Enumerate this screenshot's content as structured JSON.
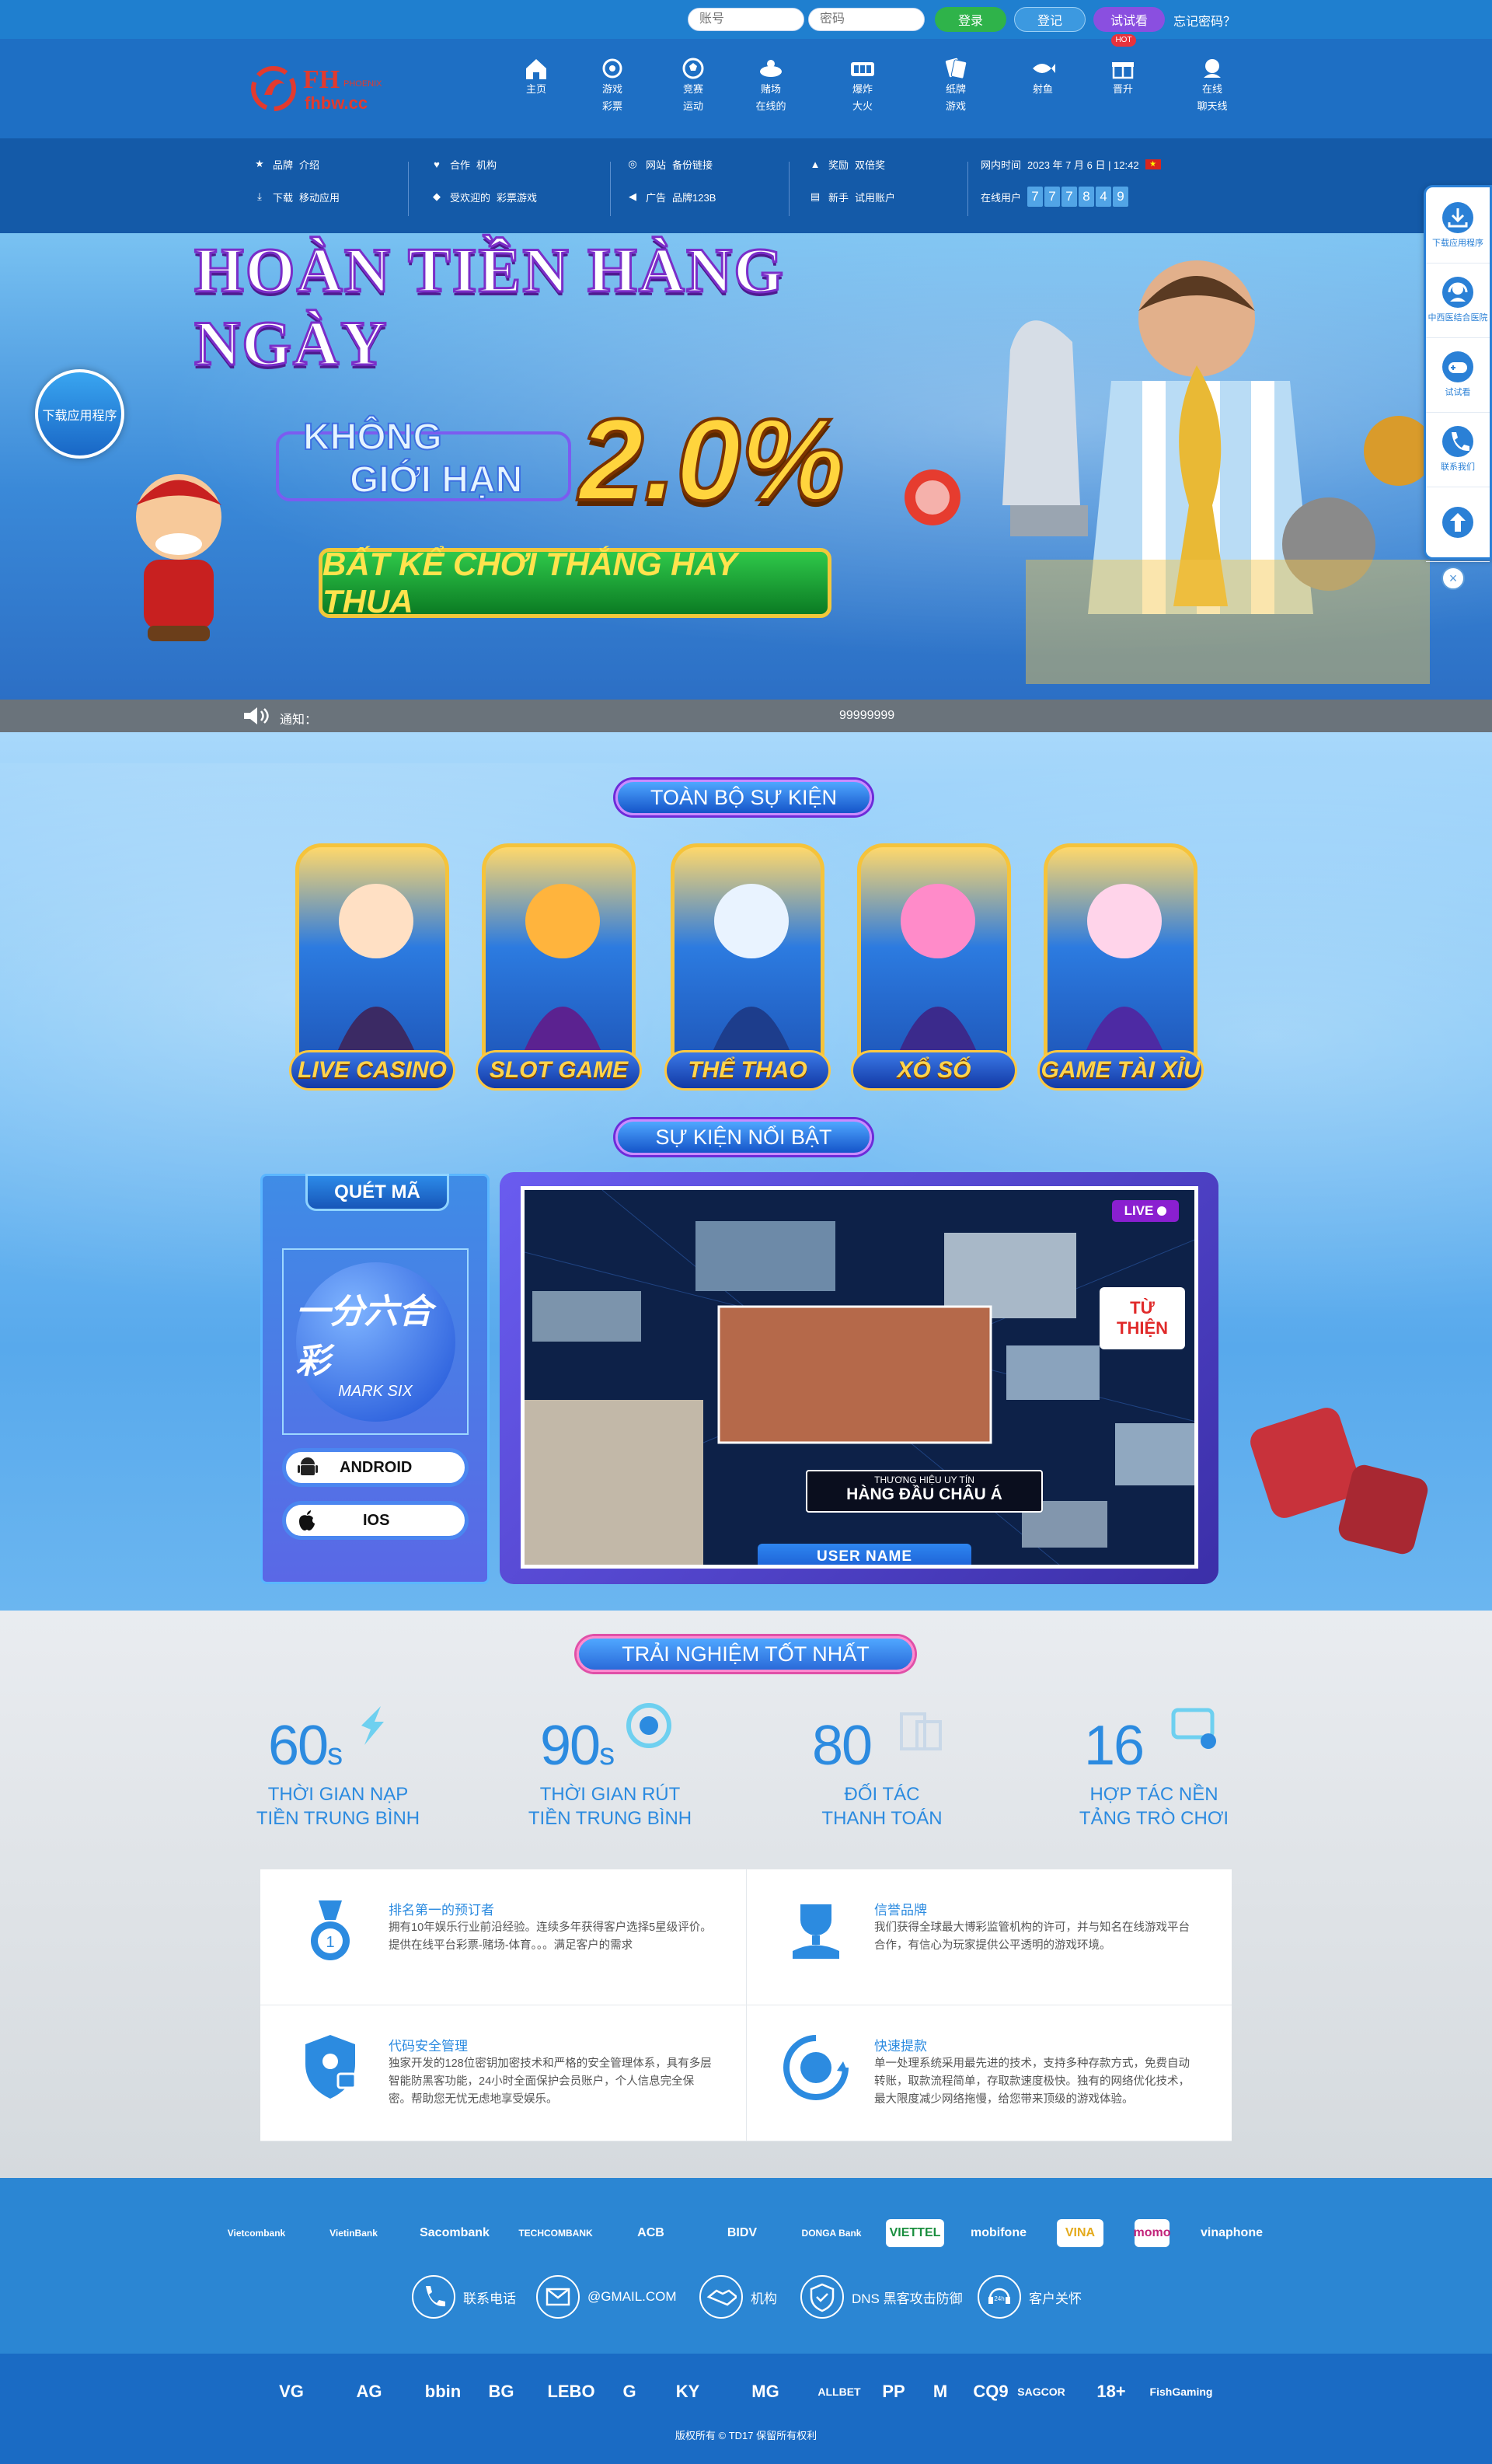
{
  "topbar": {
    "username_placeholder": "账号",
    "password_placeholder": "密码",
    "login_label": "登录",
    "register_label": "登记",
    "trial_label": "试试看",
    "hot_badge": "HOT",
    "forgot_label": "忘记密码？"
  },
  "logo": {
    "brand": "FH",
    "sub": "fhbw.cc",
    "tag": "PHOENIX"
  },
  "nav": {
    "items": [
      {
        "label": "主页",
        "icon": "home-icon"
      },
      {
        "label": "游戏彩票",
        "icon": "lottery-ball-icon"
      },
      {
        "label": "竞赛运动",
        "icon": "soccer-ball-icon"
      },
      {
        "label": "赌场在线的",
        "icon": "casino-chip-icon"
      },
      {
        "label": "爆炸大火",
        "icon": "slot-machine-icon"
      },
      {
        "label": "纸牌游戏",
        "icon": "cards-icon"
      },
      {
        "label": "射鱼",
        "icon": "fish-icon"
      },
      {
        "label": "晋升",
        "icon": "gift-icon"
      },
      {
        "label": "在线聊天线",
        "icon": "chat-agent-icon"
      }
    ]
  },
  "info": {
    "g1": {
      "a_label": "品牌",
      "a_val": "介绍",
      "b_label": "下载",
      "b_val": "移动应用"
    },
    "g2": {
      "a_label": "合作",
      "a_val": "机构",
      "b_label": "受欢迎的",
      "b_val": "彩票游戏"
    },
    "g3": {
      "a_label": "网站",
      "a_val": "备份链接",
      "b_label": "广告",
      "b_val": "品牌123B"
    },
    "g4": {
      "a_label": "奖励",
      "a_val": "双倍奖",
      "b_label": "新手",
      "b_val": "试用账户"
    },
    "time_label": "网内时间",
    "time_value": "2023 年 7 月 6 日 | 12:42",
    "online_label": "在线用户",
    "online_digits": [
      "7",
      "7",
      "7",
      "8",
      "4",
      "9"
    ]
  },
  "banner": {
    "headline": "HOÀN TIỀN HÀNG NGÀY",
    "limit_line1": "KHÔNG",
    "limit_line2": "GIỚI HẠN",
    "percent": "2.0%",
    "ribbon": "BẤT KỂ CHƠI THẮNG HAY THUA",
    "app_download": "下载应用程序"
  },
  "notice": {
    "label": "通知：",
    "text": "99999999"
  },
  "events": {
    "all_title": "TOÀN BỘ SỰ KIỆN",
    "cards": [
      {
        "label": "LIVE CASINO"
      },
      {
        "label": "SLOT GAME"
      },
      {
        "label": "THỂ THAO"
      },
      {
        "label": "XỔ SỐ"
      },
      {
        "label": "GAME TÀI XỈU"
      }
    ],
    "featured_title": "SỰ KIỆN NỔI BẬT",
    "scan_title": "QUÉT MÃ",
    "marksix_cn": "一分六合彩",
    "marksix_en": "MARK SIX",
    "android_label": "ANDROID",
    "ios_label": "IOS",
    "live_badge": "LIVE",
    "charity_line1": "TỪ",
    "charity_line2": "THIỆN",
    "brand_small": "THƯƠNG HIỆU UY TÍN",
    "brand_big": "HÀNG ĐẦU CHÂU Á",
    "user_name": "USER NAME"
  },
  "experience": {
    "title": "TRẢI NGHIỆM TỐT NHẤT",
    "stats": [
      {
        "num": "60",
        "unit": "s",
        "line1": "THỜI GIAN NẠP",
        "line2": "TIỀN TRUNG BÌNH"
      },
      {
        "num": "90",
        "unit": "s",
        "line1": "THỜI GIAN RÚT",
        "line2": "TIỀN TRUNG BÌNH"
      },
      {
        "num": "80",
        "unit": "",
        "line1": "ĐỐI TÁC",
        "line2": "THANH TOÁN"
      },
      {
        "num": "16",
        "unit": "",
        "line1": "HỢP TÁC NỀN",
        "line2": "TẢNG TRÒ CHƠI"
      }
    ],
    "features": [
      {
        "title": "排名第一的预订者",
        "text": "拥有10年娱乐行业前沿经验。连续多年获得客户选择5星级评价。提供在线平台彩票-赌场-体育。。。满足客户的需求"
      },
      {
        "title": "信誉品牌",
        "text": "我们获得全球最大博彩监管机构的许可，并与知名在线游戏平台合作，有信心为玩家提供公平透明的游戏环境。"
      },
      {
        "title": "代码安全管理",
        "text": "独家开发的128位密钥加密技术和严格的安全管理体系，具有多层智能防黑客功能，24小时全面保护会员账户，个人信息完全保密。帮助您无忧无虑地享受娱乐。"
      },
      {
        "title": "快速提款",
        "text": "单一处理系统采用最先进的技术，支持多种存款方式，免费自动转账，取款流程简单，存取款速度极快。独有的网络优化技术，最大限度减少网络拖慢，给您带来顶级的游戏体验。"
      }
    ]
  },
  "footer": {
    "banks": [
      "Vietcombank",
      "VietinBank",
      "Sacombank",
      "TECHCOMBANK",
      "ACB",
      "BIDV",
      "DONGA Bank",
      "VIETTEL",
      "mobifone",
      "VINA",
      "momo",
      "vinaphone"
    ],
    "contacts": [
      {
        "label": "联系电话",
        "icon": "phone-icon"
      },
      {
        "label": "@GMAIL.COM",
        "icon": "mail-icon"
      },
      {
        "label": "机构",
        "icon": "handshake-icon"
      },
      {
        "label": "DNS 黑客攻击防御",
        "icon": "shield-check-icon"
      },
      {
        "label": "客户关怀",
        "icon": "support-24h-icon"
      }
    ],
    "partners": [
      "VG",
      "AG",
      "bbin",
      "BG",
      "LEBO",
      "G",
      "KY",
      "MG",
      "ALLBET",
      "PP",
      "M",
      "CQ9",
      "SAGCOR",
      "18+",
      "FishGaming"
    ],
    "copyright": "版权所有 © TD17 保留所有权利"
  },
  "float_panel": {
    "items": [
      {
        "label": "下载应用程序",
        "icon": "download-icon"
      },
      {
        "label": "中西医结合医院",
        "icon": "headset-icon"
      },
      {
        "label": "试试看",
        "icon": "gamepad-icon"
      },
      {
        "label": "联系我们",
        "icon": "phone-icon"
      },
      {
        "label": "",
        "icon": "arrow-up-icon"
      }
    ]
  },
  "colors": {
    "primary": "#1e6fc4",
    "accent": "#2c8be0",
    "login_green": "#2fb34a",
    "trial_purple": "#8a4fe0"
  }
}
